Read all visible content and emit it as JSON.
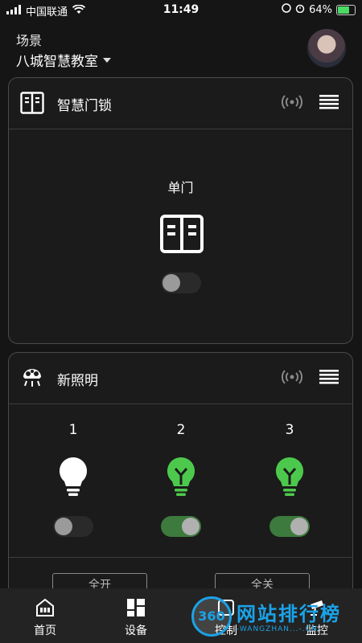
{
  "status": {
    "carrier": "中国联通",
    "time": "11:49",
    "battery": "64%",
    "battery_level": 0.64
  },
  "scene": {
    "label": "场景",
    "name": "八城智慧教室"
  },
  "lock_card": {
    "title": "智慧门锁",
    "door_label": "单门",
    "toggle_on": false
  },
  "light_card": {
    "title": "新照明",
    "lights": [
      {
        "label": "1",
        "on": false,
        "color": "#ffffff"
      },
      {
        "label": "2",
        "on": true,
        "color": "#4cc94c"
      },
      {
        "label": "3",
        "on": true,
        "color": "#4cc94c"
      }
    ],
    "all_on_label": "全开",
    "all_off_label": "全关"
  },
  "tabs": [
    {
      "label": "首页",
      "icon": "home-icon"
    },
    {
      "label": "设备",
      "icon": "grid-icon"
    },
    {
      "label": "控制",
      "icon": "control-icon"
    },
    {
      "label": "监控",
      "icon": "monitor-icon"
    }
  ],
  "watermark": {
    "logo": "360",
    "text": "网站排行榜",
    "sub": "-WANGZHAN...-.CN-"
  },
  "colors": {
    "accent_green": "#4cc94c",
    "watermark_blue": "#1aa3e8"
  }
}
